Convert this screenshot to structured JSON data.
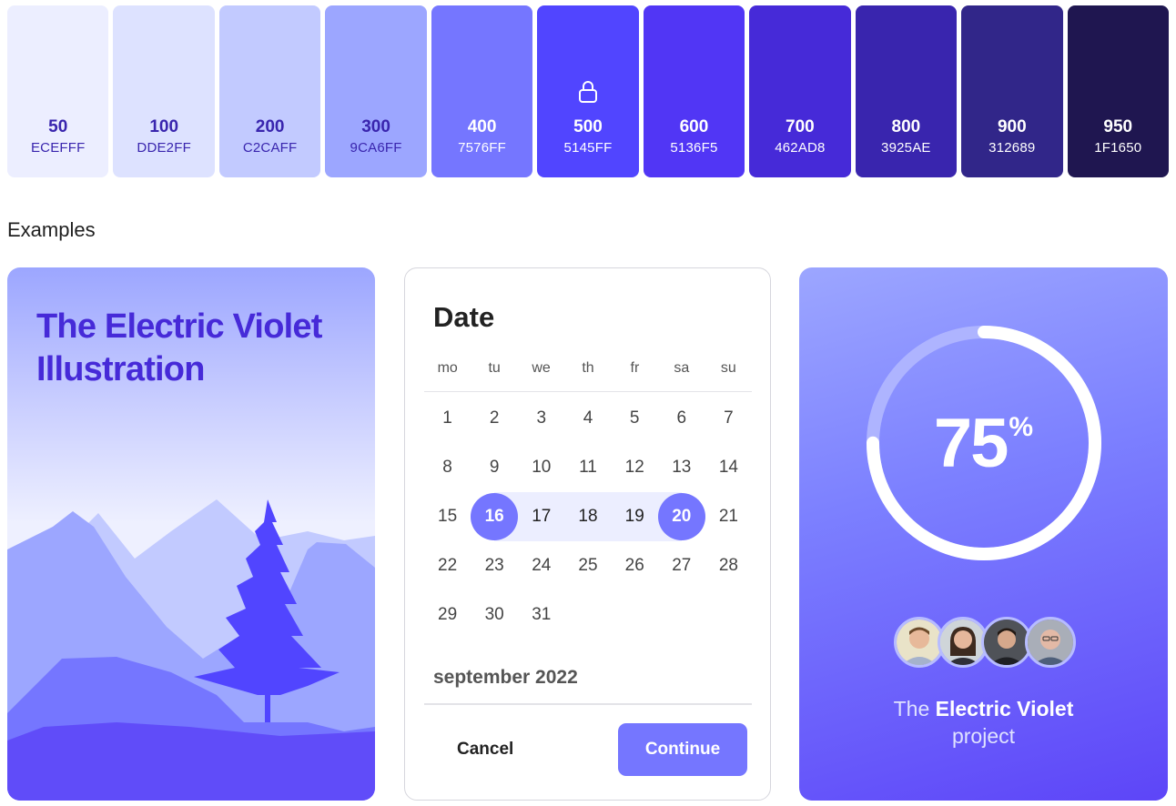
{
  "palette": [
    {
      "shade": "50",
      "hex": "ECEFFF",
      "bg": "#eceeff",
      "fg": "#3925ae"
    },
    {
      "shade": "100",
      "hex": "DDE2FF",
      "bg": "#dde2ff",
      "fg": "#3925ae"
    },
    {
      "shade": "200",
      "hex": "C2CAFF",
      "bg": "#c2caff",
      "fg": "#3925ae"
    },
    {
      "shade": "300",
      "hex": "9CA6FF",
      "bg": "#9ca6ff",
      "fg": "#3925ae"
    },
    {
      "shade": "400",
      "hex": "7576FF",
      "bg": "#7576ff",
      "fg": "#ffffff"
    },
    {
      "shade": "500",
      "hex": "5145FF",
      "bg": "#5145ff",
      "fg": "#ffffff",
      "locked": true
    },
    {
      "shade": "600",
      "hex": "5136F5",
      "bg": "#5136f5",
      "fg": "#ffffff"
    },
    {
      "shade": "700",
      "hex": "462AD8",
      "bg": "#462ad8",
      "fg": "#ffffff"
    },
    {
      "shade": "800",
      "hex": "3925AE",
      "bg": "#3925ae",
      "fg": "#ffffff"
    },
    {
      "shade": "900",
      "hex": "312689",
      "bg": "#312689",
      "fg": "#ffffff"
    },
    {
      "shade": "950",
      "hex": "1F1650",
      "bg": "#1f1650",
      "fg": "#ffffff"
    }
  ],
  "section_title": "Examples",
  "illustration": {
    "title": "The Electric Violet Illustration"
  },
  "datepicker": {
    "title": "Date",
    "weekdays": [
      "mo",
      "tu",
      "we",
      "th",
      "fr",
      "sa",
      "su"
    ],
    "days": [
      "1",
      "2",
      "3",
      "4",
      "5",
      "6",
      "7",
      "8",
      "9",
      "10",
      "11",
      "12",
      "13",
      "14",
      "15",
      "16",
      "17",
      "18",
      "19",
      "20",
      "21",
      "22",
      "23",
      "24",
      "25",
      "26",
      "27",
      "28",
      "29",
      "30",
      "31"
    ],
    "range_start": 16,
    "range_end": 20,
    "month": "september 2022",
    "cancel_label": "Cancel",
    "continue_label": "Continue"
  },
  "progress": {
    "value": "75",
    "fraction": 0.75,
    "unit": "%",
    "project_prefix": "The",
    "project_name": "Electric Violet",
    "project_suffix": "project"
  },
  "colors": {
    "accent": "#7576ff",
    "brand": "#5145ff",
    "text_dark": "#462ad8"
  }
}
